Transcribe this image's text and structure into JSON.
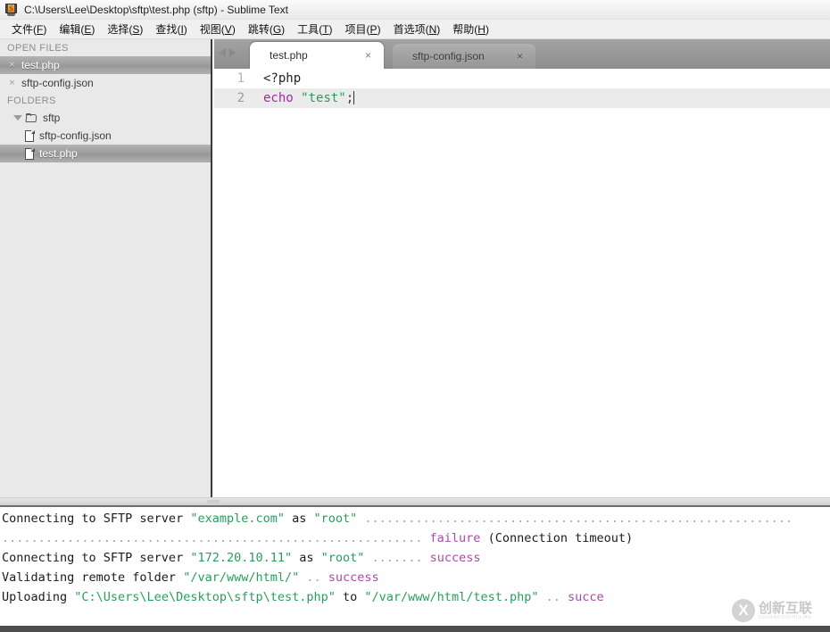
{
  "window": {
    "title": "C:\\Users\\Lee\\Desktop\\sftp\\test.php (sftp) - Sublime Text",
    "icon": "sublime-text-icon",
    "icon_letter": "S"
  },
  "menubar": {
    "items": [
      {
        "label": "文件",
        "accel": "F"
      },
      {
        "label": "编辑",
        "accel": "E"
      },
      {
        "label": "选择",
        "accel": "S"
      },
      {
        "label": "查找",
        "accel": "I"
      },
      {
        "label": "视图",
        "accel": "V"
      },
      {
        "label": "跳转",
        "accel": "G"
      },
      {
        "label": "工具",
        "accel": "T"
      },
      {
        "label": "项目",
        "accel": "P"
      },
      {
        "label": "首选项",
        "accel": "N"
      },
      {
        "label": "帮助",
        "accel": "H"
      }
    ]
  },
  "sidebar": {
    "open_files_header": "OPEN FILES",
    "open_files": [
      {
        "label": "test.php",
        "selected": true,
        "close_icon": "×"
      },
      {
        "label": "sftp-config.json",
        "selected": false,
        "close_icon": "×"
      }
    ],
    "folders_header": "FOLDERS",
    "folder": {
      "label": "sftp",
      "expanded": true
    },
    "folder_files": [
      {
        "label": "sftp-config.json",
        "selected": false
      },
      {
        "label": "test.php",
        "selected": true
      }
    ]
  },
  "tabs": {
    "nav_prev": "◀",
    "nav_next": "▶",
    "items": [
      {
        "label": "test.php",
        "active": true,
        "close": "×"
      },
      {
        "label": "sftp-config.json",
        "active": false,
        "close": "×"
      }
    ]
  },
  "editor": {
    "lines": [
      {
        "number": "1",
        "current": false,
        "text": "<?php"
      },
      {
        "number": "2",
        "current": true,
        "text": "echo \"test\";"
      }
    ],
    "line1_text": "<?php",
    "line2_kw": "echo",
    "line2_space": " ",
    "line2_str": "\"test\"",
    "line2_punc": ";"
  },
  "console": {
    "lines": [
      {
        "parts": [
          {
            "t": "Connecting to SFTP server ",
            "c": "plain"
          },
          {
            "t": "\"example.com\"",
            "c": "str"
          },
          {
            "t": " as ",
            "c": "plain"
          },
          {
            "t": "\"root\"",
            "c": "str"
          },
          {
            "t": " ...........................................................",
            "c": "dots"
          }
        ]
      },
      {
        "parts": [
          {
            "t": "..........................................................",
            "c": "dots"
          },
          {
            "t": " failure",
            "c": "res"
          },
          {
            "t": " (Connection timeout)",
            "c": "plain"
          }
        ]
      },
      {
        "parts": [
          {
            "t": "Connecting to SFTP server ",
            "c": "plain"
          },
          {
            "t": "\"172.20.10.11\"",
            "c": "str"
          },
          {
            "t": " as ",
            "c": "plain"
          },
          {
            "t": "\"root\"",
            "c": "str"
          },
          {
            "t": " .......",
            "c": "dots"
          },
          {
            "t": " success",
            "c": "res"
          }
        ]
      },
      {
        "parts": [
          {
            "t": "Validating remote folder ",
            "c": "plain"
          },
          {
            "t": "\"/var/www/html/\"",
            "c": "str"
          },
          {
            "t": " ..",
            "c": "dots"
          },
          {
            "t": " success",
            "c": "res"
          }
        ]
      },
      {
        "parts": [
          {
            "t": "Uploading ",
            "c": "plain"
          },
          {
            "t": "\"C:\\Users\\Lee\\Desktop\\sftp\\test.php\"",
            "c": "str"
          },
          {
            "t": " to ",
            "c": "plain"
          },
          {
            "t": "\"/var/www/html/test.php\"",
            "c": "str"
          },
          {
            "t": " ..",
            "c": "dots"
          },
          {
            "t": " succe",
            "c": "res"
          }
        ]
      }
    ]
  },
  "watermark": {
    "mark": "X",
    "cn": "创新互联",
    "en": "CHUANGXIN HULIAN"
  },
  "colors": {
    "string_green": "#2a9d5c",
    "result_purple": "#a64ca6",
    "keyword_purple": "#a626a4",
    "tabbar_gray": "#9a9a9a",
    "sidebar_gray": "#e9e9e9",
    "selection_gray": "#9d9d9d"
  }
}
